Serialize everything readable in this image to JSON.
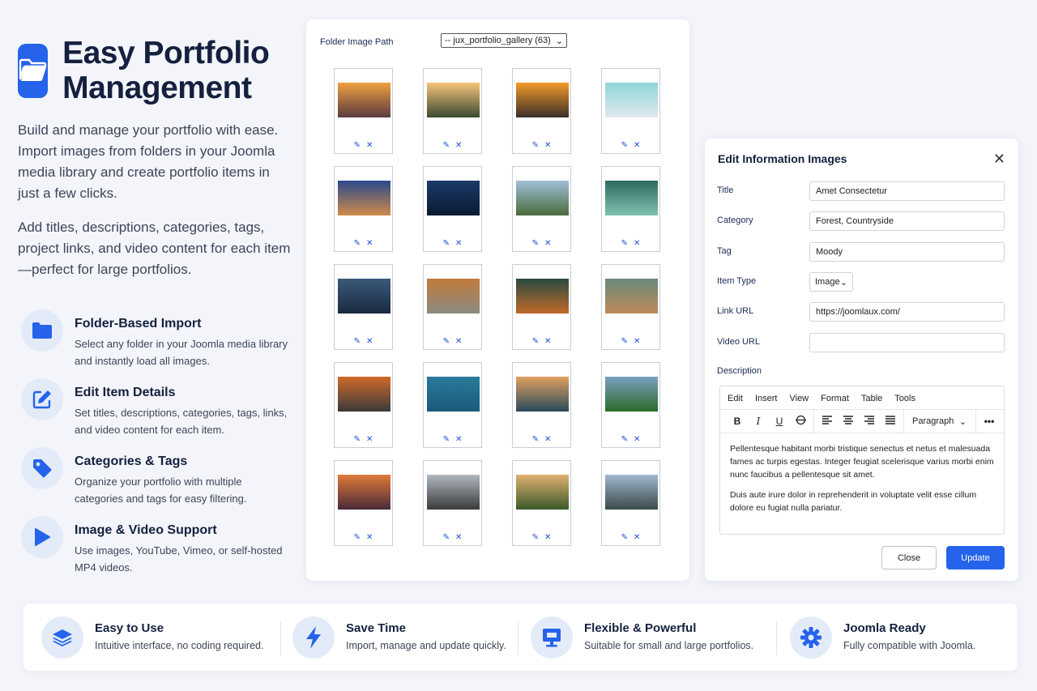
{
  "hero": {
    "title": "Easy Portfolio Management",
    "para1": "Build and manage your portfolio with ease. Import images from folders in your Joomla media library and create portfolio items in just a few clicks.",
    "para2": "Add titles, descriptions, categories, tags, project links, and video content for each item—perfect for large portfolios."
  },
  "features": [
    {
      "title": "Folder-Based Import",
      "desc": "Select any folder in your Joomla media library and instantly load all images.",
      "icon": "folder-icon"
    },
    {
      "title": "Edit Item Details",
      "desc": "Set titles, descriptions, categories, tags, links, and video content for each item.",
      "icon": "edit-icon"
    },
    {
      "title": "Categories & Tags",
      "desc": "Organize your portfolio with multiple categories and tags for easy filtering.",
      "icon": "tag-icon"
    },
    {
      "title": "Image & Video Support",
      "desc": "Use images, YouTube, Vimeo, or self-hosted MP4 videos.",
      "icon": "play-icon"
    }
  ],
  "gallery": {
    "path_label": "Folder Image Path",
    "path_value": "-- jux_portfolio_gallery (63)",
    "edit_glyph": "✎",
    "delete_glyph": "✕"
  },
  "dialog": {
    "title": "Edit Information Images",
    "fields": {
      "title_label": "Title",
      "title_value": "Amet Consectetur",
      "category_label": "Category",
      "category_value": "Forest, Countryside",
      "tag_label": "Tag",
      "tag_value": "Moody",
      "item_type_label": "Item Type",
      "item_type_value": "Image",
      "link_url_label": "Link URL",
      "link_url_value": "https://joomlaux.com/",
      "video_url_label": "Video URL",
      "video_url_value": ""
    },
    "description_label": "Description",
    "editor_menu": [
      "Edit",
      "Insert",
      "View",
      "Format",
      "Table",
      "Tools"
    ],
    "editor_block": "Paragraph",
    "editor_p1": "Pellentesque habitant morbi tristique senectus et netus et malesuada fames ac turpis egestas. Integer feugiat scelerisque varius morbi enim nunc faucibus a pellentesque sit amet.",
    "editor_p2": "Duis aute irure dolor in reprehenderit in voluptate velit esse cillum dolore eu fugiat nulla pariatur.",
    "close_label": "Close",
    "update_label": "Update"
  },
  "strip": [
    {
      "title": "Easy to Use",
      "desc": "Intuitive interface, no coding required.",
      "icon": "layers-icon"
    },
    {
      "title": "Save Time",
      "desc": "Import, manage and update quickly.",
      "icon": "lightning-icon"
    },
    {
      "title": "Flexible & Powerful",
      "desc": "Suitable for small and large portfolios.",
      "icon": "monitor-icon"
    },
    {
      "title": "Joomla Ready",
      "desc": "Fully compatible with Joomla.",
      "icon": "gear-icon"
    }
  ],
  "colors": {
    "accent": "#2563eb",
    "title": "#14203e",
    "icon_bg": "#e4ebf8"
  }
}
